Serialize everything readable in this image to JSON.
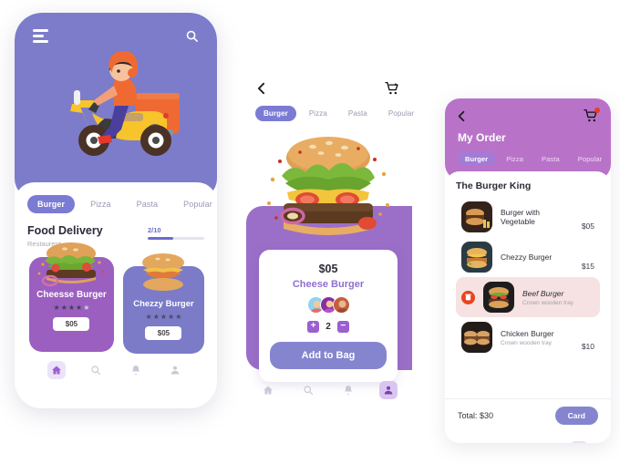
{
  "theme": {
    "primary_purple": "#7c7cca",
    "accent_violet": "#9b5fd0",
    "pink_purple": "#b873c9",
    "button_blue": "#8585cf",
    "delete_red": "#e8441d",
    "badge_red": "#f03a20"
  },
  "phone_home": {
    "menu_icon": "hamburger-menu-icon",
    "search_icon": "search-icon",
    "hero_illustration": "delivery-scooter-rider",
    "tabs": [
      {
        "label": "Burger",
        "active": true
      },
      {
        "label": "Pizza",
        "active": false
      },
      {
        "label": "Pasta",
        "active": false
      },
      {
        "label": "Popular",
        "active": false
      }
    ],
    "section_title": "Food Delivery",
    "section_subtitle": "Restaurent",
    "progress_label": "2/10",
    "progress_percent": 45,
    "cards": [
      {
        "name": "Cheesse Burger",
        "price": "$05",
        "stars_filled": 4,
        "stars_total": 5
      },
      {
        "name": "Chezzy Burger",
        "price": "$05",
        "stars_filled": 4,
        "stars_total": 5
      }
    ],
    "nav": [
      {
        "icon": "home-icon",
        "active": true
      },
      {
        "icon": "search-icon",
        "active": false
      },
      {
        "icon": "bell-icon",
        "active": false
      },
      {
        "icon": "profile-icon",
        "active": false
      }
    ]
  },
  "phone_detail": {
    "back_icon": "chevron-left-icon",
    "cart_icon": "cart-icon",
    "tabs": [
      {
        "label": "Burger",
        "active": true
      },
      {
        "label": "Pizza",
        "active": false
      },
      {
        "label": "Pasta",
        "active": false
      },
      {
        "label": "Popular",
        "active": false
      }
    ],
    "hero_image": "burger-hero",
    "price": "$05",
    "product_name": "Cheese Burger",
    "avatars": 3,
    "quantity": "2",
    "increase_label": "+",
    "decrease_label": "−",
    "add_button": "Add to Bag",
    "nav": [
      {
        "icon": "home-icon",
        "active": false
      },
      {
        "icon": "search-icon",
        "active": false
      },
      {
        "icon": "bell-icon",
        "active": false
      },
      {
        "icon": "profile-icon",
        "active": true
      }
    ]
  },
  "phone_order": {
    "back_icon": "chevron-left-icon",
    "cart_icon": "cart-icon",
    "cart_has_badge": true,
    "title": "My Order",
    "tabs": [
      {
        "label": "Burger",
        "active": true
      },
      {
        "label": "Pizza",
        "active": false
      },
      {
        "label": "Pasta",
        "active": false
      },
      {
        "label": "Popular",
        "active": false
      }
    ],
    "restaurant": "The Burger King",
    "items": [
      {
        "name": "Burger  with Vegetable",
        "sub": "",
        "price": "$05",
        "selected": false,
        "deletable": false
      },
      {
        "name": "Chezzy Burger",
        "sub": "",
        "price": "$15",
        "selected": false,
        "deletable": false
      },
      {
        "name": "Beef Burger",
        "sub": "Crown wooden tray",
        "price": "",
        "selected": true,
        "deletable": true
      },
      {
        "name": "Chicken Burger",
        "sub": "Crown wooden tray",
        "price": "$10",
        "selected": false,
        "deletable": false
      }
    ],
    "total": "Total: $30",
    "pay_button": "Card",
    "nav": [
      {
        "icon": "home-icon",
        "active": false
      },
      {
        "icon": "search-icon",
        "active": false
      },
      {
        "icon": "bell-icon",
        "active": false
      },
      {
        "icon": "profile-icon",
        "active": true
      }
    ]
  }
}
